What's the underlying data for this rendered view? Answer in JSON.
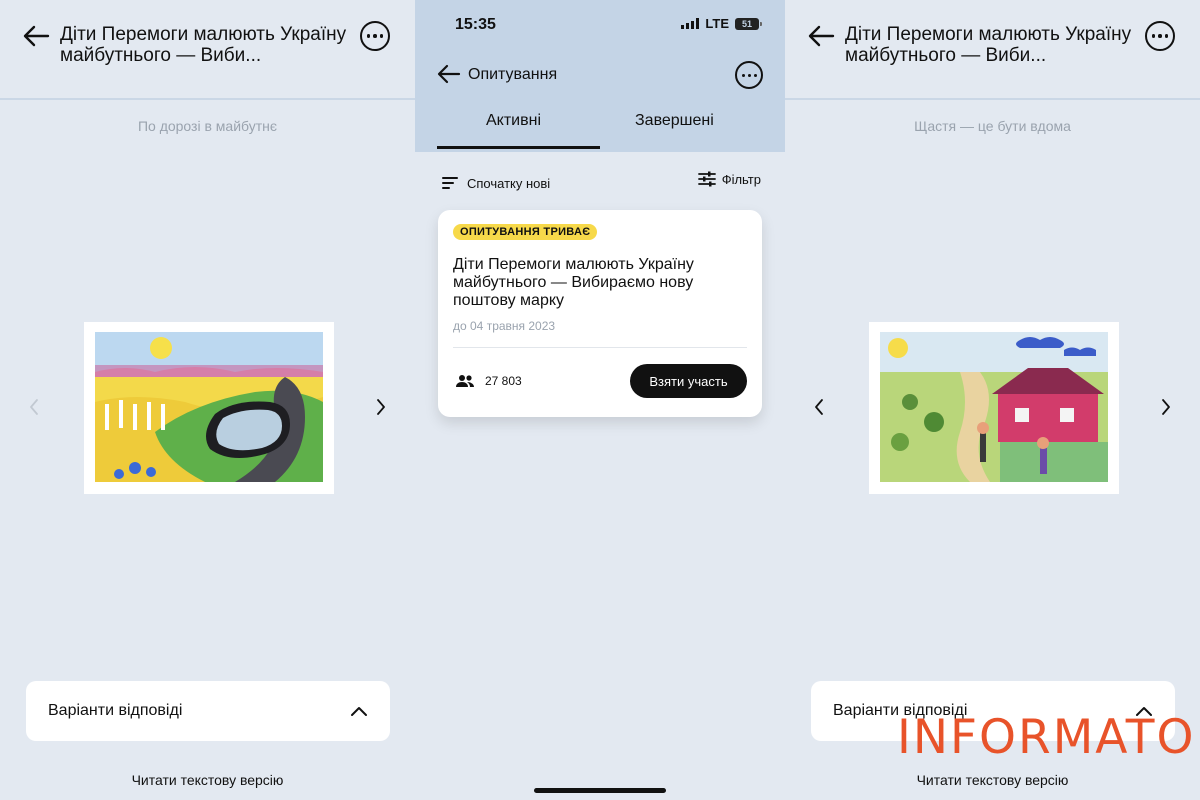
{
  "left": {
    "title": "Діти Перемоги малюють Україну майбутнього — Виби...",
    "caption": "По дорозі в майбутнє",
    "answers_label": "Варіанти відповіді",
    "read_text": "Читати текстову версію"
  },
  "middle": {
    "status": {
      "time": "15:35",
      "network": "LTE",
      "battery": "51"
    },
    "header_title": "Опитування",
    "tabs": [
      {
        "label": "Активні",
        "active": true
      },
      {
        "label": "Завершені",
        "active": false
      }
    ],
    "sort_label": "Спочатку нові",
    "filter_label": "Фільтр",
    "card": {
      "badge": "ОПИТУВАННЯ ТРИВАЄ",
      "title": "Діти Перемоги малюють Україну майбутнього — Вибираємо нову поштову марку",
      "date": "до 04 травня 2023",
      "participants": "27 803",
      "button": "Взяти участь"
    }
  },
  "right": {
    "title": "Діти Перемоги малюють Україну майбутнього — Виби...",
    "caption": "Щастя — це бути вдома",
    "answers_label": "Варіанти відповіді",
    "read_text": "Читати текстову версію"
  },
  "watermark": "INFORMATOR",
  "colors": {
    "background": "#e3e9f1",
    "header_blue": "#c4d4e6",
    "badge_yellow": "#f7d94a",
    "watermark_orange": "#e8532a"
  },
  "icons": [
    "back-arrow-icon",
    "more-icon",
    "chevron-left-icon",
    "chevron-right-icon",
    "chevron-up-icon",
    "sort-icon",
    "filter-icon",
    "people-icon"
  ]
}
